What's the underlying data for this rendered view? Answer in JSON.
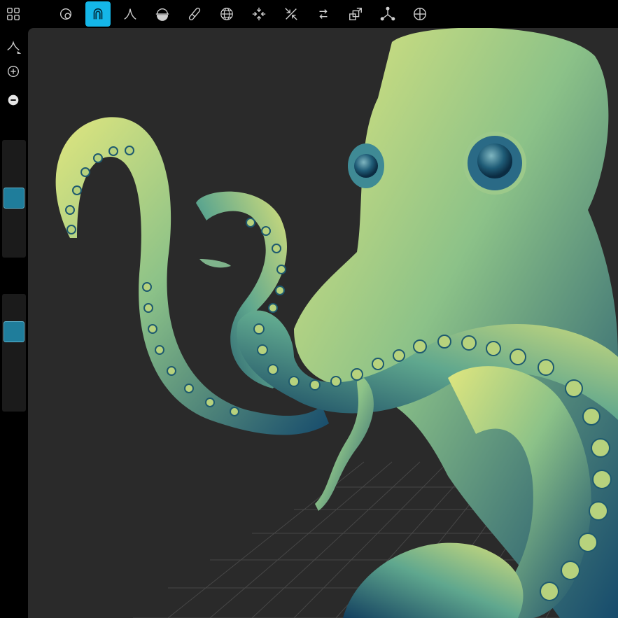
{
  "toolbar": {
    "active_tool": "clay",
    "tools": [
      "apps-grid",
      "layers",
      "clay",
      "crease",
      "flatten",
      "brush-stick",
      "sphere",
      "pinch-in",
      "pinch-out",
      "move",
      "transform",
      "gizmo",
      "scene-globe"
    ]
  },
  "sidebar": {
    "top_buttons": [
      "curve-tool-icon",
      "zoom-in-icon",
      "zoom-out-icon"
    ],
    "radius_slider": {
      "value": 0.5
    },
    "intensity_slider": {
      "value": 0.3
    }
  },
  "colors": {
    "accent": "#14b6e8",
    "viewport_bg": "#2a2a2a",
    "grid": "#4a4a4a",
    "model_light": "#d8e27a",
    "model_mid": "#6fae8a",
    "model_dark": "#154a6b",
    "slider_handle": "#1f7d9b"
  }
}
